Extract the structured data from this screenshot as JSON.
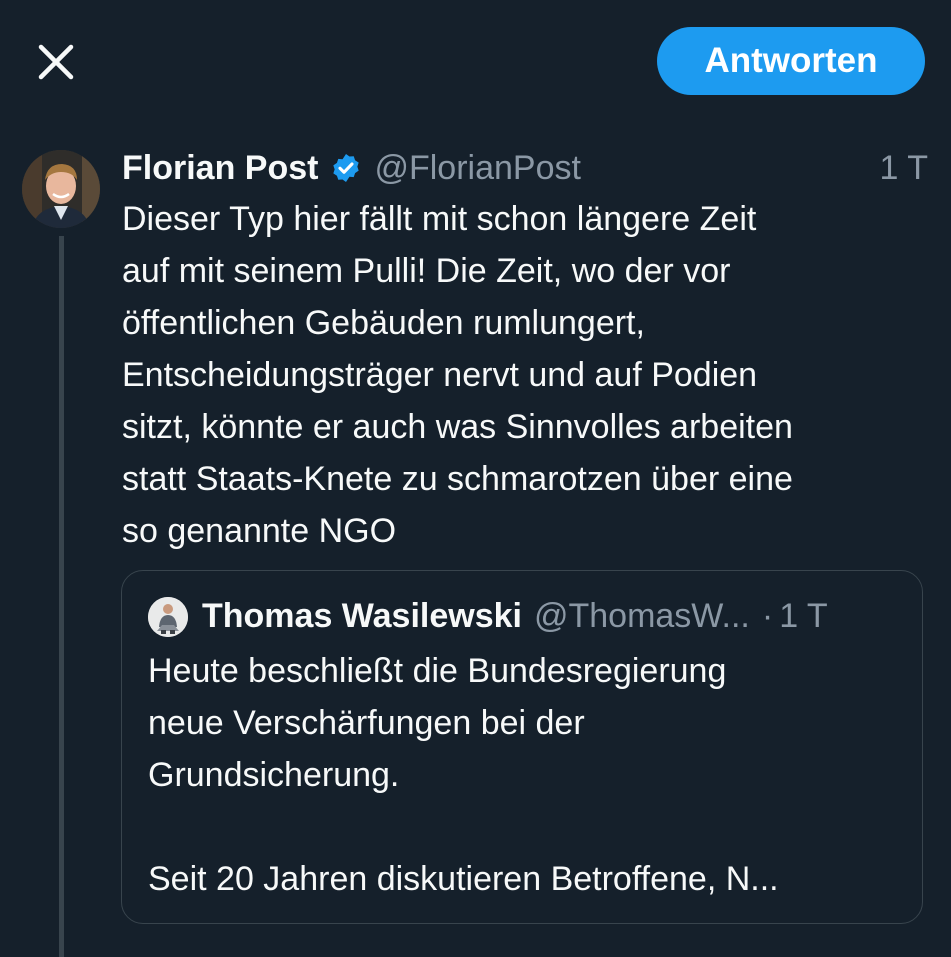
{
  "topbar": {
    "close_icon": "close-icon",
    "reply_label": "Antworten"
  },
  "tweet": {
    "author_name": "Florian Post",
    "verified_icon": "verified-badge-icon",
    "handle": "@FlorianPost",
    "time": "1 T",
    "text_lines": [
      "Dieser Typ hier fällt mit schon längere Zeit",
      "auf mit seinem Pulli! Die Zeit, wo der vor",
      "öffentlichen Gebäuden rumlungert,",
      "Entscheidungsträger nervt und auf Podien",
      "sitzt, könnte er auch was Sinnvolles arbeiten",
      "statt Staats-Knete zu schmarotzen über eine",
      "so genannte NGO"
    ]
  },
  "quote": {
    "author_name": "Thomas Wasilewski",
    "handle": "@ThomasW...",
    "separator": "·",
    "time": "1 T",
    "text_lines": [
      "Heute beschließt die Bundesregierung",
      "neue Verschärfungen bei der",
      "Grundsicherung.",
      "",
      "Seit 20 Jahren diskutieren Betroffene,  N..."
    ]
  },
  "colors": {
    "background": "#15202b",
    "accent": "#1d9bf0",
    "text": "#f7f9f9",
    "secondary_text": "#8b98a5",
    "border": "#38444d"
  }
}
